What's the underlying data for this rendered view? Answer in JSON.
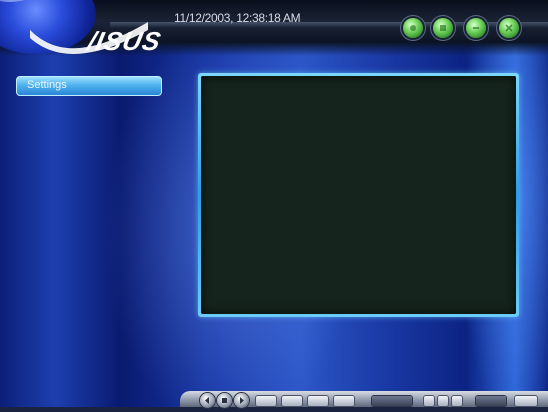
{
  "header": {
    "datetime": "11/12/2003, 12:38:18 AM",
    "logo_text": "/ISUS"
  },
  "sidebar": {
    "settings_label": "Settings"
  },
  "top_buttons": [
    "round-button-1",
    "round-button-2",
    "round-button-3",
    "round-button-4"
  ],
  "colors": {
    "background_blue": "#1d3fb0",
    "accent_cyan": "#4fb2ee",
    "video_screen": "#15241c",
    "top_button_green": "#6ed35a"
  }
}
